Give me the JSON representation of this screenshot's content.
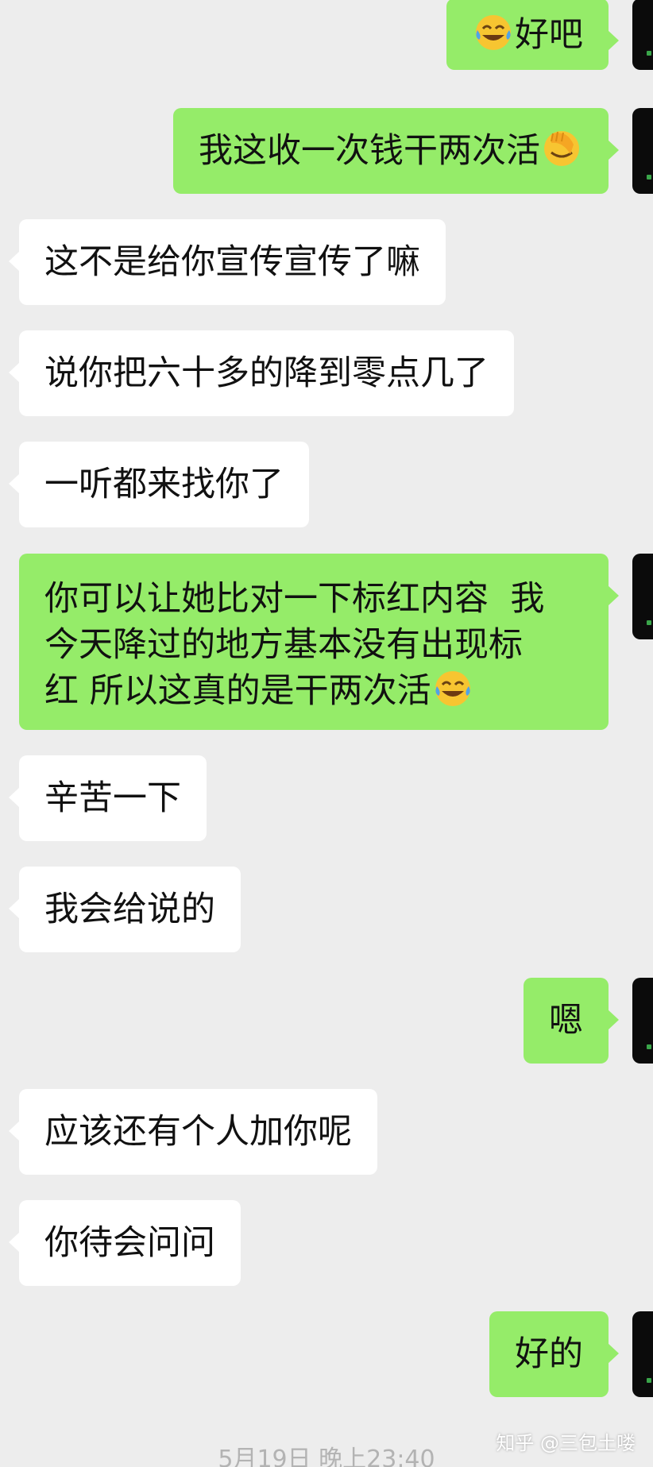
{
  "colors": {
    "background": "#ededed",
    "incoming_bubble": "#ffffff",
    "outgoing_bubble": "#95ec69",
    "text": "#111111"
  },
  "messages": [
    {
      "side": "out",
      "pre_emoji": "tears-of-joy",
      "text": "好吧"
    },
    {
      "side": "out",
      "text": "我这收一次钱干两次活",
      "post_emoji": "facepalm"
    },
    {
      "side": "in",
      "text": "这不是给你宣传宣传了嘛"
    },
    {
      "side": "in",
      "text": "说你把六十多的降到零点几了"
    },
    {
      "side": "in",
      "text": "一听都来找你了"
    },
    {
      "side": "out",
      "lines": [
        "你可以让她比对一下标红内容  我",
        "今天降过的地方基本没有出现标",
        "红 所以这真的是干两次活"
      ],
      "post_emoji": "tears-of-joy"
    },
    {
      "side": "in",
      "text": "辛苦一下"
    },
    {
      "side": "in",
      "text": "我会给说的"
    },
    {
      "side": "out",
      "text": "嗯"
    },
    {
      "side": "in",
      "text": "应该还有个人加你呢"
    },
    {
      "side": "in",
      "text": "你待会问问"
    },
    {
      "side": "out",
      "text": "好的"
    }
  ],
  "timestamp": "5月19日 晚上23:40",
  "watermark": "知乎 @三包土喽"
}
